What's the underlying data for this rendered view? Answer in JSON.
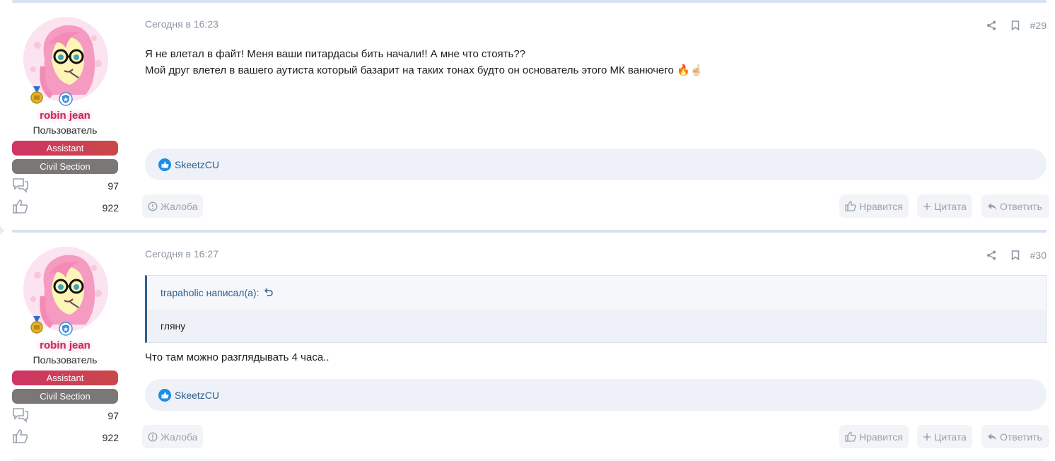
{
  "posts": [
    {
      "date": "Сегодня в 16:23",
      "number": "#29",
      "user": {
        "name": "robin jean",
        "title": "Пользователь",
        "banners": [
          "Assistant",
          "Civil Section"
        ],
        "messages": "97",
        "reactions": "922"
      },
      "body_lines": [
        "Я не влетал в файт! Меня ваши питардасы бить начали!! А мне что стоять??",
        "Мой друг влетел в вашего аутиста который базарит на таких тонах будто он основатель этого МК ванючего"
      ],
      "body_emoji": "🔥☝🏻",
      "liked_by": "SkeetzCU",
      "actions": {
        "report": "Жалоба",
        "like": "Нравится",
        "quote": "Цитата",
        "reply": "Ответить"
      }
    },
    {
      "date": "Сегодня в 16:27",
      "number": "#30",
      "user": {
        "name": "robin jean",
        "title": "Пользователь",
        "banners": [
          "Assistant",
          "Civil Section"
        ],
        "messages": "97",
        "reactions": "922"
      },
      "quote": {
        "author": "trapaholic написал(а):",
        "text": "гляну"
      },
      "body_lines": [
        "Что там можно разглядывать 4 часа.."
      ],
      "liked_by": "SkeetzCU",
      "actions": {
        "report": "Жалоба",
        "like": "Нравится",
        "quote": "Цитата",
        "reply": "Ответить"
      }
    }
  ],
  "icons": {
    "messages": "speech-bubbles-icon",
    "reactions": "thumbs-up-icon",
    "share": "share-icon",
    "bookmark": "bookmark-icon",
    "report": "alert-circle-icon",
    "reply": "reply-arrow-icon",
    "quote": "plus-icon",
    "like": "thumbs-up-icon"
  },
  "colors": {
    "username": "#c6285b",
    "assistant_banner": "#cf3565",
    "civil_banner": "#7a7776",
    "link": "#2f5e8e",
    "muted": "#8c96a3",
    "reaction_bg": "#eef2f8",
    "like_blue": "#1d8ee8"
  }
}
